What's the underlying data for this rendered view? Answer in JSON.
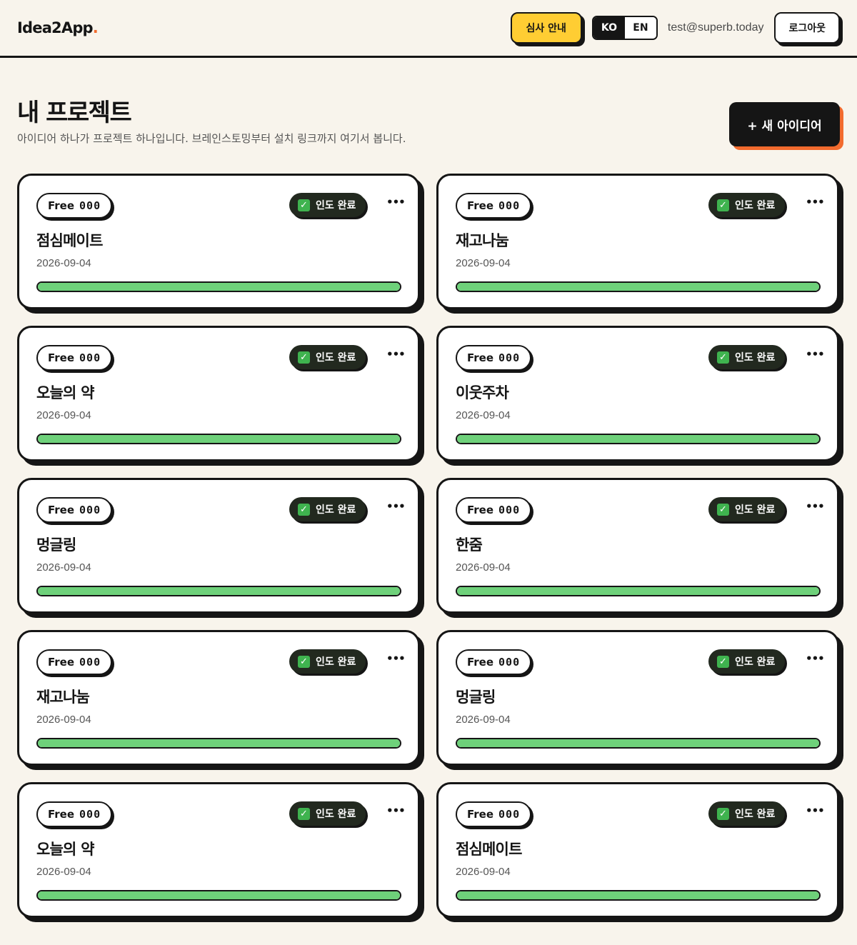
{
  "header": {
    "logo": "Idea2App",
    "logo_dot": ".",
    "review_label": "심사 안내",
    "lang_ko": "KO",
    "lang_en": "EN",
    "email": "test@superb.today",
    "logout_label": "로그아웃"
  },
  "main": {
    "title": "내 프로젝트",
    "subtitle": "아이디어 하나가 프로젝트 하나입니다. 브레인스토밍부터 설치 링크까지 여기서 봅니다.",
    "new_button": "+ 새 아이디어"
  },
  "projects": [
    {
      "plan": "Free",
      "code": "000",
      "status": "인도 완료",
      "title": "점심메이트",
      "date": "2026-09-04",
      "progress": 1.0
    },
    {
      "plan": "Free",
      "code": "000",
      "status": "인도 완료",
      "title": "재고나눔",
      "date": "2026-09-04",
      "progress": 1.0
    },
    {
      "plan": "Free",
      "code": "000",
      "status": "인도 완료",
      "title": "오늘의 약",
      "date": "2026-09-04",
      "progress": 1.0
    },
    {
      "plan": "Free",
      "code": "000",
      "status": "인도 완료",
      "title": "이웃주차",
      "date": "2026-09-04",
      "progress": 1.0
    },
    {
      "plan": "Free",
      "code": "000",
      "status": "인도 완료",
      "title": "멍글링",
      "date": "2026-09-04",
      "progress": 1.0
    },
    {
      "plan": "Free",
      "code": "000",
      "status": "인도 완료",
      "title": "한줌",
      "date": "2026-09-04",
      "progress": 1.0
    },
    {
      "plan": "Free",
      "code": "000",
      "status": "인도 완료",
      "title": "재고나눔",
      "date": "2026-09-04",
      "progress": 1.0
    },
    {
      "plan": "Free",
      "code": "000",
      "status": "인도 완료",
      "title": "멍글링",
      "date": "2026-09-04",
      "progress": 1.0
    },
    {
      "plan": "Free",
      "code": "000",
      "status": "인도 완료",
      "title": "오늘의 약",
      "date": "2026-09-04",
      "progress": 1.0
    },
    {
      "plan": "Free",
      "code": "000",
      "status": "인도 완료",
      "title": "점심메이트",
      "date": "2026-09-04",
      "progress": 1.0
    }
  ],
  "icons": {
    "status": "check-icon",
    "more": "more-icon"
  },
  "colors": {
    "background": "#f8f4ec",
    "accent_yellow": "#ffcd33",
    "accent_orange": "#f26b2e",
    "progress_green": "#6ed17a",
    "badge_dark": "#22291f"
  }
}
